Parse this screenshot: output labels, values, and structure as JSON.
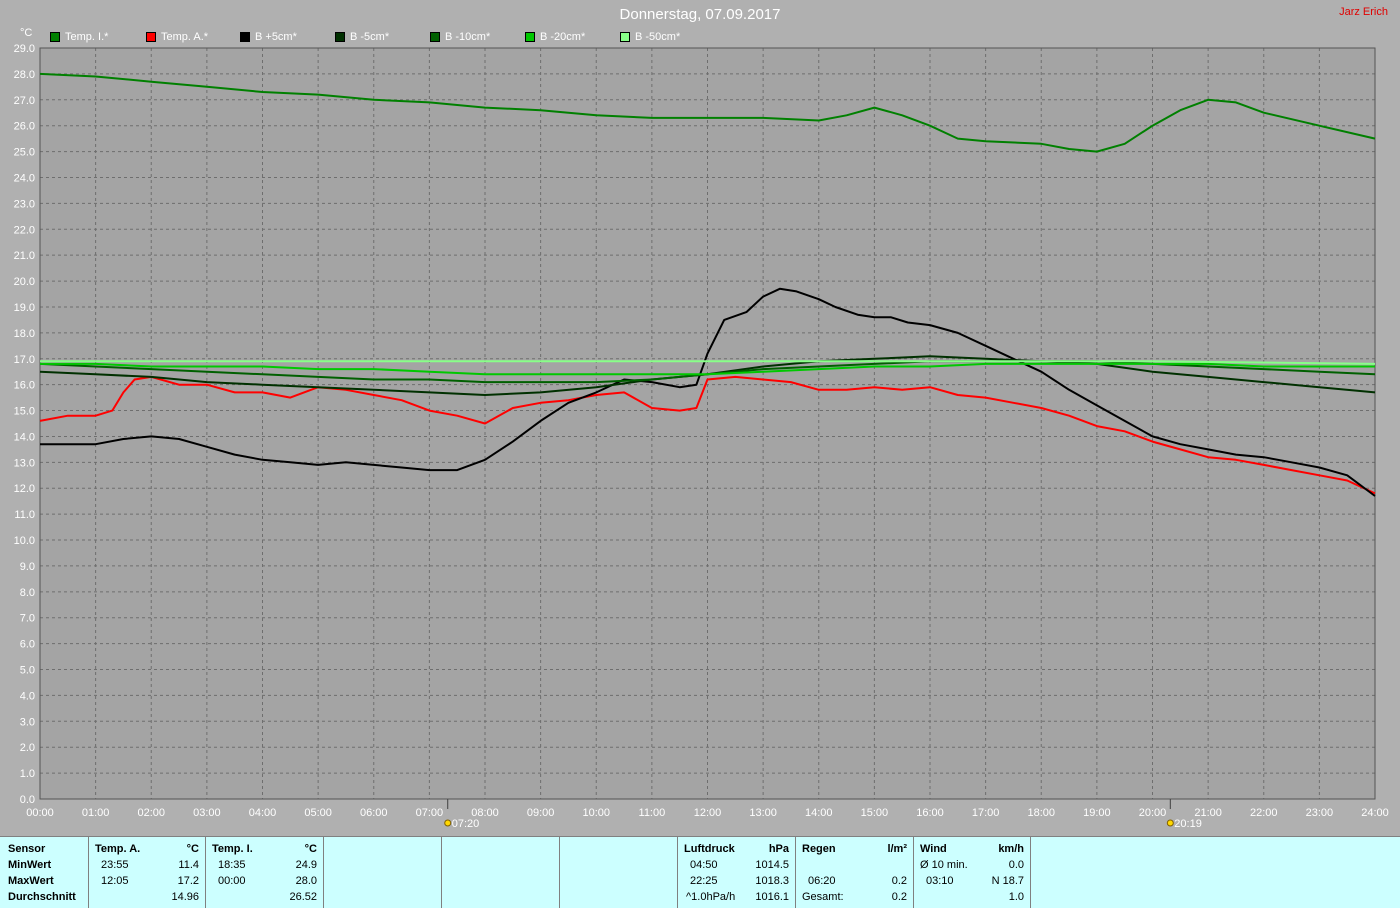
{
  "title": "Donnerstag, 07.09.2017",
  "author": "Jarz Erich",
  "chart_data": {
    "type": "line",
    "ylabel": "°C",
    "ylim": [
      0,
      29
    ],
    "ystep": 1,
    "xlim": [
      0,
      24
    ],
    "xticks": [
      "00:00",
      "01:00",
      "02:00",
      "03:00",
      "04:00",
      "05:00",
      "06:00",
      "07:00",
      "08:00",
      "09:00",
      "10:00",
      "11:00",
      "12:00",
      "13:00",
      "14:00",
      "15:00",
      "16:00",
      "17:00",
      "18:00",
      "19:00",
      "20:00",
      "21:00",
      "22:00",
      "23:00",
      "24:00"
    ],
    "grid": true,
    "markers": [
      {
        "x": 7.33,
        "label": "07:20"
      },
      {
        "x": 20.32,
        "label": "20:19"
      }
    ],
    "series": [
      {
        "name": "Temp. I.*",
        "color": "#008000",
        "x": [
          0,
          1,
          2,
          3,
          4,
          5,
          6,
          7,
          8,
          9,
          10,
          11,
          12,
          13,
          14,
          14.5,
          15,
          15.5,
          16,
          16.5,
          17,
          18,
          18.5,
          19,
          19.5,
          20,
          20.5,
          21,
          21.5,
          22,
          23,
          24
        ],
        "y": [
          28.0,
          27.9,
          27.7,
          27.5,
          27.3,
          27.2,
          27.0,
          26.9,
          26.7,
          26.6,
          26.4,
          26.3,
          26.3,
          26.3,
          26.2,
          26.4,
          26.7,
          26.4,
          26.0,
          25.5,
          25.4,
          25.3,
          25.1,
          25.0,
          25.3,
          26.0,
          26.6,
          27.0,
          26.9,
          26.5,
          26.0,
          25.5
        ]
      },
      {
        "name": "Temp. A.*",
        "color": "#ff0000",
        "x": [
          0,
          0.5,
          1,
          1.3,
          1.5,
          1.7,
          2,
          2.5,
          3,
          3.5,
          4,
          4.5,
          5,
          5.5,
          6,
          6.5,
          7,
          7.5,
          8,
          8.5,
          9,
          9.5,
          10,
          10.5,
          11,
          11.5,
          11.8,
          12,
          12.5,
          13,
          13.5,
          14,
          14.5,
          15,
          15.5,
          16,
          16.5,
          17,
          17.5,
          18,
          18.5,
          19,
          19.5,
          20,
          20.5,
          21,
          21.5,
          22,
          22.5,
          23,
          23.5,
          24
        ],
        "y": [
          14.6,
          14.8,
          14.8,
          15.0,
          15.7,
          16.2,
          16.3,
          16.0,
          16.0,
          15.7,
          15.7,
          15.5,
          15.9,
          15.8,
          15.6,
          15.4,
          15.0,
          14.8,
          14.5,
          15.1,
          15.3,
          15.4,
          15.6,
          15.7,
          15.1,
          15.0,
          15.1,
          16.2,
          16.3,
          16.2,
          16.1,
          15.8,
          15.8,
          15.9,
          15.8,
          15.9,
          15.6,
          15.5,
          15.3,
          15.1,
          14.8,
          14.4,
          14.2,
          13.8,
          13.5,
          13.2,
          13.1,
          12.9,
          12.7,
          12.5,
          12.3,
          11.8
        ]
      },
      {
        "name": "B +5cm*",
        "color": "#000000",
        "x": [
          0,
          0.5,
          1,
          1.5,
          2,
          2.5,
          3,
          3.5,
          4,
          4.5,
          5,
          5.5,
          6,
          6.5,
          7,
          7.5,
          8,
          8.5,
          9,
          9.5,
          10,
          10.5,
          11,
          11.5,
          11.8,
          12,
          12.3,
          12.7,
          13,
          13.3,
          13.6,
          14,
          14.3,
          14.7,
          15,
          15.3,
          15.6,
          16,
          16.5,
          17,
          17.5,
          18,
          18.5,
          19,
          19.5,
          20,
          20.5,
          21,
          21.5,
          22,
          22.5,
          23,
          23.5,
          24
        ],
        "y": [
          13.7,
          13.7,
          13.7,
          13.9,
          14.0,
          13.9,
          13.6,
          13.3,
          13.1,
          13.0,
          12.9,
          13.0,
          12.9,
          12.8,
          12.7,
          12.7,
          13.1,
          13.8,
          14.6,
          15.3,
          15.7,
          16.2,
          16.1,
          15.9,
          16.0,
          17.2,
          18.5,
          18.8,
          19.4,
          19.7,
          19.6,
          19.3,
          19.0,
          18.7,
          18.6,
          18.6,
          18.4,
          18.3,
          18.0,
          17.5,
          17.0,
          16.5,
          15.8,
          15.2,
          14.6,
          14.0,
          13.7,
          13.5,
          13.3,
          13.2,
          13.0,
          12.8,
          12.5,
          11.7
        ]
      },
      {
        "name": "B -5cm*",
        "color": "#003000",
        "x": [
          0,
          1,
          2,
          3,
          4,
          5,
          6,
          7,
          8,
          9,
          10,
          11,
          12,
          13,
          14,
          15,
          16,
          17,
          18,
          19,
          20,
          21,
          22,
          23,
          24
        ],
        "y": [
          16.5,
          16.4,
          16.3,
          16.1,
          16.0,
          15.9,
          15.8,
          15.7,
          15.6,
          15.7,
          15.9,
          16.2,
          16.4,
          16.7,
          16.9,
          17.0,
          17.1,
          17.0,
          16.9,
          16.8,
          16.5,
          16.3,
          16.1,
          15.9,
          15.7
        ]
      },
      {
        "name": "B -10cm*",
        "color": "#006000",
        "x": [
          0,
          1,
          2,
          3,
          4,
          5,
          6,
          7,
          8,
          9,
          10,
          11,
          12,
          13,
          14,
          15,
          16,
          17,
          18,
          19,
          20,
          21,
          22,
          23,
          24
        ],
        "y": [
          16.8,
          16.7,
          16.6,
          16.5,
          16.4,
          16.3,
          16.2,
          16.2,
          16.1,
          16.1,
          16.1,
          16.2,
          16.4,
          16.6,
          16.7,
          16.8,
          16.9,
          16.9,
          16.9,
          16.9,
          16.8,
          16.7,
          16.6,
          16.5,
          16.4
        ]
      },
      {
        "name": "B -20cm*",
        "color": "#00c800",
        "x": [
          0,
          1,
          2,
          3,
          4,
          5,
          6,
          7,
          8,
          9,
          10,
          11,
          12,
          13,
          14,
          15,
          16,
          17,
          18,
          19,
          20,
          21,
          22,
          23,
          24
        ],
        "y": [
          16.8,
          16.8,
          16.7,
          16.7,
          16.7,
          16.6,
          16.6,
          16.5,
          16.4,
          16.4,
          16.4,
          16.4,
          16.4,
          16.5,
          16.6,
          16.7,
          16.7,
          16.8,
          16.8,
          16.8,
          16.8,
          16.8,
          16.7,
          16.7,
          16.7
        ]
      },
      {
        "name": "B -50cm*",
        "color": "#88ff88",
        "x": [
          0,
          4,
          8,
          12,
          16,
          20,
          24
        ],
        "y": [
          16.9,
          16.9,
          16.9,
          16.9,
          16.9,
          16.9,
          16.8
        ]
      }
    ]
  },
  "table": {
    "rows": [
      "Sensor",
      "MinWert",
      "MaxWert",
      "Durchschnitt"
    ],
    "temp_a": {
      "title": "Temp. A.",
      "unit": "°C",
      "min_time": "23:55",
      "min": "11.4",
      "max_time": "12:05",
      "max": "17.2",
      "avg": "14.96"
    },
    "temp_i": {
      "title": "Temp. I.",
      "unit": "°C",
      "min_time": "18:35",
      "min": "24.9",
      "max_time": "00:00",
      "max": "28.0",
      "avg": "26.52"
    },
    "pressure": {
      "title": "Luftdruck",
      "unit": "hPa",
      "min_time": "04:50",
      "min": "1014.5",
      "max_time": "22:25",
      "max": "1018.3",
      "rate_label": "^1.0hPa/h",
      "avg": "1016.1"
    },
    "rain": {
      "title": "Regen",
      "unit": "l/m²",
      "max_time": "06:20",
      "max": "0.2",
      "total_label": "Gesamt:",
      "total": "0.2"
    },
    "wind": {
      "title": "Wind",
      "unit": "km/h",
      "avg_label": "Ø 10 min.",
      "avg": "0.0",
      "max_time": "03:10",
      "max": "N 18.7",
      "mean": "1.0"
    }
  }
}
